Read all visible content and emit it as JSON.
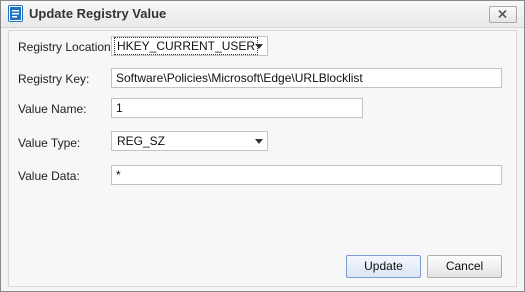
{
  "window": {
    "title": "Update Registry Value"
  },
  "form": {
    "registry_location": {
      "label": "Registry Location:",
      "value": "HKEY_CURRENT_USER"
    },
    "registry_key": {
      "label": "Registry Key:",
      "value": "Software\\Policies\\Microsoft\\Edge\\URLBlocklist"
    },
    "value_name": {
      "label": "Value Name:",
      "value": "1"
    },
    "value_type": {
      "label": "Value Type:",
      "value": "REG_SZ"
    },
    "value_data": {
      "label": "Value Data:",
      "value": "*"
    }
  },
  "buttons": {
    "update_label": "Update",
    "cancel_label": "Cancel"
  },
  "icons": {
    "app": "document-edit-icon",
    "close": "close-icon",
    "dropdown": "chevron-down-icon"
  },
  "colors": {
    "app_icon_accent": "#1f73c4",
    "primary_button_border": "#7a9cd3"
  }
}
